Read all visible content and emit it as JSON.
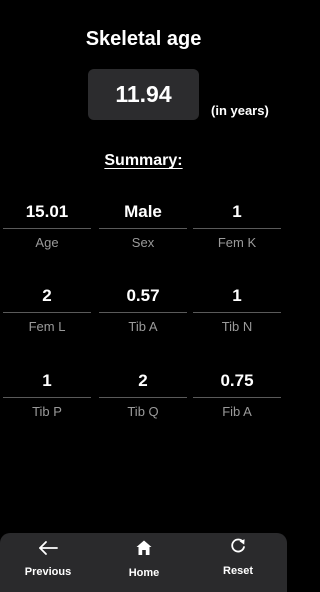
{
  "header": {
    "title": "Skeletal age"
  },
  "result": {
    "value": "11.94",
    "unit": "(in years)"
  },
  "summary": {
    "heading": "Summary:",
    "items": [
      {
        "value": "15.01",
        "label": "Age"
      },
      {
        "value": "Male",
        "label": "Sex"
      },
      {
        "value": "1",
        "label": "Fem K"
      },
      {
        "value": "2",
        "label": "Fem L"
      },
      {
        "value": "0.57",
        "label": "Tib A"
      },
      {
        "value": "1",
        "label": "Tib N"
      },
      {
        "value": "1",
        "label": "Tib P"
      },
      {
        "value": "2",
        "label": "Tib Q"
      },
      {
        "value": "0.75",
        "label": "Fib A"
      }
    ]
  },
  "nav": {
    "items": [
      {
        "label": "Previous",
        "icon": "arrow-left-icon"
      },
      {
        "label": "Home",
        "icon": "home-icon"
      },
      {
        "label": "Reset",
        "icon": "reset-icon"
      }
    ]
  },
  "colors": {
    "background": "#000000",
    "result_box": "#2c2c2e",
    "nav_bar": "#2a2a2c",
    "label_text": "#9a9a9a",
    "divider": "#5a5a5a"
  }
}
